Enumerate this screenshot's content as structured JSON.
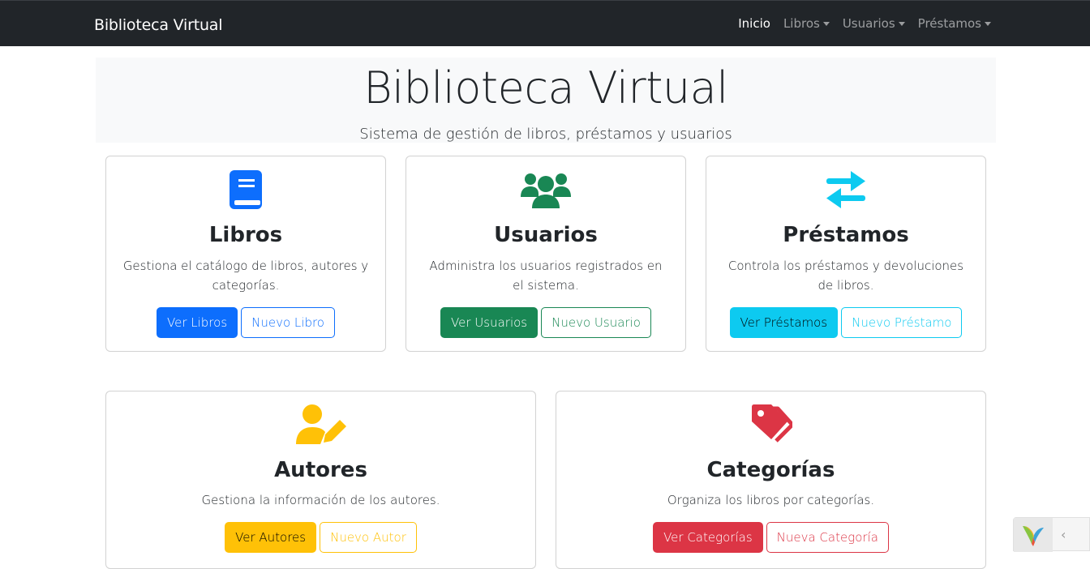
{
  "navbar": {
    "brand": "Biblioteca Virtual",
    "items": [
      {
        "label": "Inicio"
      },
      {
        "label": "Libros"
      },
      {
        "label": "Usuarios"
      },
      {
        "label": "Préstamos"
      }
    ]
  },
  "hero": {
    "title": "Biblioteca Virtual",
    "subtitle": "Sistema de gestión de libros, préstamos y usuarios"
  },
  "cards": {
    "libros": {
      "icon": "book-icon",
      "color": "#0d6efd",
      "title": "Libros",
      "text": "Gestiona el catálogo de libros, autores y categorías.",
      "primary": "Ver Libros",
      "secondary": "Nuevo Libro"
    },
    "usuarios": {
      "icon": "users-icon",
      "color": "#198754",
      "title": "Usuarios",
      "text": "Administra los usuarios registrados en el sistema.",
      "primary": "Ver Usuarios",
      "secondary": "Nuevo Usuario"
    },
    "prestamos": {
      "icon": "exchange-arrows-icon",
      "color": "#0dcaf0",
      "title": "Préstamos",
      "text": "Controla los préstamos y devoluciones de libros.",
      "primary": "Ver Préstamos",
      "secondary": "Nuevo Préstamo"
    },
    "autores": {
      "icon": "user-pen-icon",
      "color": "#ffc107",
      "title": "Autores",
      "text": "Gestiona la información de los autores.",
      "primary": "Ver Autores",
      "secondary": "Nuevo Autor"
    },
    "categorias": {
      "icon": "tags-icon",
      "color": "#dc3545",
      "title": "Categorías",
      "text": "Organiza los libros por categorías.",
      "primary": "Ver Categorías",
      "secondary": "Nueva Categoría"
    }
  },
  "debug_toolbar": {
    "logo": "yii-logo-icon",
    "toggle": "‹"
  }
}
